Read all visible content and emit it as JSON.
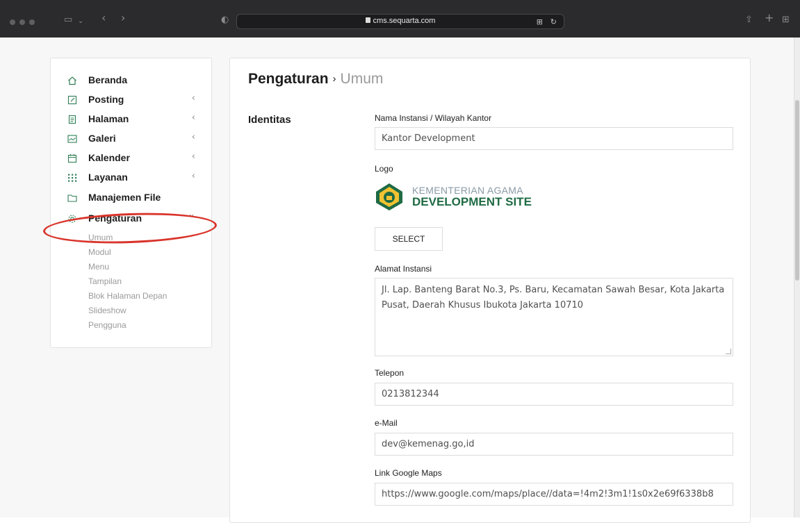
{
  "browser": {
    "url": "cms.sequarta.com"
  },
  "sidebar": {
    "items": [
      {
        "label": "Beranda",
        "icon": "home-icon",
        "chevron": ""
      },
      {
        "label": "Posting",
        "icon": "edit-icon",
        "chevron": "‹"
      },
      {
        "label": "Halaman",
        "icon": "page-icon",
        "chevron": "‹"
      },
      {
        "label": "Galeri",
        "icon": "image-icon",
        "chevron": "‹"
      },
      {
        "label": "Kalender",
        "icon": "calendar-icon",
        "chevron": "‹"
      },
      {
        "label": "Layanan",
        "icon": "grid-icon",
        "chevron": "‹"
      },
      {
        "label": "Manajemen File",
        "icon": "folder-icon",
        "chevron": ""
      },
      {
        "label": "Pengaturan",
        "icon": "gear-icon",
        "chevron": "⌄"
      }
    ],
    "sub_items": [
      "Umum",
      "Modul",
      "Menu",
      "Tampilan",
      "Blok Halaman Depan",
      "Slideshow",
      "Pengguna"
    ]
  },
  "main": {
    "breadcrumb_parent": "Pengaturan",
    "breadcrumb_sep": "›",
    "breadcrumb_current": "Umum",
    "section": "Identitas",
    "fields": {
      "nama_label": "Nama Instansi / Wilayah Kantor",
      "nama_value": "Kantor Development",
      "logo_label": "Logo",
      "logo_line1": "KEMENTERIAN AGAMA",
      "logo_line2": "DEVELOPMENT SITE",
      "select_label": "SELECT",
      "alamat_label": "Alamat Instansi",
      "alamat_value": "Jl. Lap. Banteng Barat No.3, Ps. Baru, Kecamatan Sawah Besar, Kota Jakarta Pusat, Daerah Khusus Ibukota Jakarta 10710",
      "telepon_label": "Telepon",
      "telepon_value": "0213812344",
      "email_label": "e-Mail",
      "email_value": "dev@kemenag.go,id",
      "maps_label": "Link Google Maps",
      "maps_value": "https://www.google.com/maps/place//data=!4m2!3m1!1s0x2e69f6338b8"
    }
  },
  "colors": {
    "accent_green": "#2e7d55",
    "annotation_red": "#d9342b"
  }
}
